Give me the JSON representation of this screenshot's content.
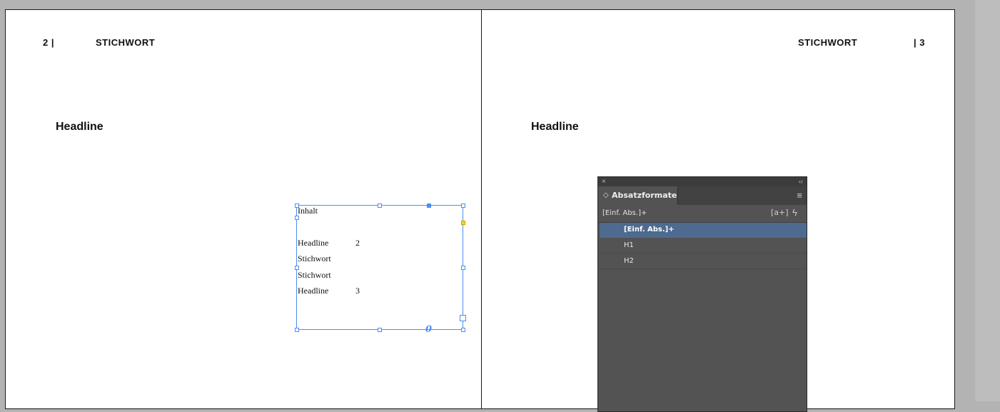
{
  "pages": {
    "left": {
      "page_number": "2 |",
      "running_header": "STICHWORT",
      "headline": "Headline"
    },
    "right": {
      "page_number": "| 3",
      "running_header": "STICHWORT",
      "headline": "Headline"
    }
  },
  "toc": {
    "title": "Inhalt",
    "entries": [
      {
        "label": "Headline",
        "page": "2"
      },
      {
        "label": "Stichwort",
        "page": ""
      },
      {
        "label": "Stichwort",
        "page": ""
      },
      {
        "label": "Headline",
        "page": "3"
      }
    ]
  },
  "panel": {
    "close_glyph": "×",
    "collapse_glyph": "‹‹",
    "tab_arrows": "◇",
    "tab_label": "Absatzformate",
    "menu_glyph": "≡",
    "current_style": "[Einf. Abs.]+",
    "new_style_glyph": "[a+]",
    "bolt_glyph": "ϟ",
    "styles": [
      "[Einf. Abs.]+",
      "H1",
      "H2"
    ],
    "selected_index": 0
  },
  "colors": {
    "selection": "#4a8ef0",
    "panel_bg": "#535353",
    "row_selected": "#4e6a8f",
    "pasteboard": "#b3b3b3"
  }
}
